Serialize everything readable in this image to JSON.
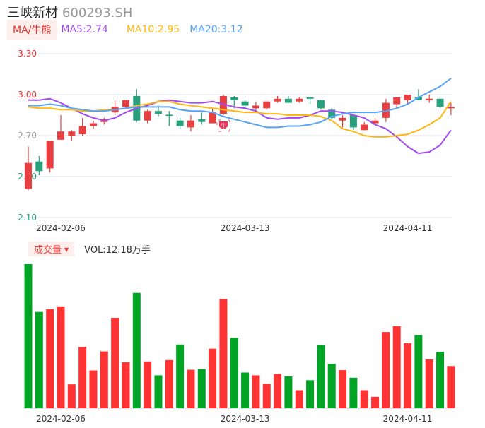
{
  "header": {
    "name": "三峡新材",
    "code": "600293.SH"
  },
  "ma_legend": {
    "tag": "MA/牛熊",
    "ma5": "MA5:2.74",
    "ma10": "MA10:2.95",
    "ma20": "MA20:3.12"
  },
  "volume_legend": {
    "tag": "成交量",
    "tag_icon": "triangle-down-icon",
    "value": "VOL:12.18万手"
  },
  "marker": {
    "label": "牛",
    "index": 18
  },
  "colors": {
    "up": "#e84040",
    "down": "#26a17c",
    "vol_up": "#ff3333",
    "vol_down": "#00a526",
    "ma5": "#a24bf0",
    "ma10": "#fdb714",
    "ma20": "#56a3f5",
    "grid": "#dde3f0"
  },
  "chart_data": [
    {
      "type": "candlestick",
      "title": "三峡新材 600293.SH",
      "ylim": [
        2.1,
        3.3
      ],
      "yticks": [
        "3.30",
        "3.00",
        "2.70",
        "2.40",
        "2.10"
      ],
      "ytick_values": [
        3.3,
        3.0,
        2.7,
        2.4,
        2.1
      ],
      "xtick_labels": [
        {
          "index": 3,
          "label": "2024-02-06"
        },
        {
          "index": 20,
          "label": "2024-03-13"
        },
        {
          "index": 35,
          "label": "2024-04-11"
        }
      ],
      "grid": true,
      "ohlc": [
        [
          2.31,
          2.62,
          2.3,
          2.5
        ],
        [
          2.51,
          2.55,
          2.41,
          2.44
        ],
        [
          2.46,
          2.66,
          2.43,
          2.66
        ],
        [
          2.67,
          2.85,
          2.67,
          2.73
        ],
        [
          2.7,
          2.74,
          2.66,
          2.73
        ],
        [
          2.71,
          2.83,
          2.7,
          2.77
        ],
        [
          2.77,
          2.81,
          2.75,
          2.79
        ],
        [
          2.8,
          2.83,
          2.78,
          2.82
        ],
        [
          2.87,
          2.96,
          2.85,
          2.91
        ],
        [
          2.91,
          2.96,
          2.9,
          2.96
        ],
        [
          2.99,
          3.04,
          2.8,
          2.81
        ],
        [
          2.81,
          2.89,
          2.79,
          2.88
        ],
        [
          2.88,
          2.92,
          2.84,
          2.86
        ],
        [
          2.853,
          2.88,
          2.77,
          2.848
        ],
        [
          2.81,
          2.83,
          2.75,
          2.77
        ],
        [
          2.76,
          2.85,
          2.73,
          2.81
        ],
        [
          2.82,
          2.87,
          2.78,
          2.8
        ],
        [
          2.79,
          2.9,
          2.79,
          2.87
        ],
        [
          2.86,
          3.0,
          2.85,
          2.99
        ],
        [
          2.98,
          2.99,
          2.9,
          2.96
        ],
        [
          2.95,
          2.96,
          2.9,
          2.92
        ],
        [
          2.9,
          2.95,
          2.88,
          2.92
        ],
        [
          2.9,
          2.95,
          2.89,
          2.95
        ],
        [
          2.95,
          2.99,
          2.94,
          2.97
        ],
        [
          2.97,
          2.99,
          2.94,
          2.94
        ],
        [
          2.95,
          2.98,
          2.94,
          2.97
        ],
        [
          2.98,
          2.99,
          2.93,
          2.97
        ],
        [
          2.96,
          2.96,
          2.89,
          2.9
        ],
        [
          2.89,
          2.9,
          2.82,
          2.83
        ],
        [
          2.81,
          2.85,
          2.76,
          2.83
        ],
        [
          2.85,
          2.85,
          2.74,
          2.76
        ],
        [
          2.74,
          2.8,
          2.74,
          2.78
        ],
        [
          2.79,
          2.83,
          2.78,
          2.81
        ],
        [
          2.83,
          2.97,
          2.8,
          2.94
        ],
        [
          2.93,
          2.98,
          2.9,
          2.98
        ],
        [
          2.96,
          3.0,
          2.93,
          3.0
        ],
        [
          2.98,
          3.04,
          2.96,
          2.96
        ],
        [
          2.96,
          3.0,
          2.94,
          2.97
        ],
        [
          2.97,
          2.97,
          2.9,
          2.91
        ],
        [
          2.9,
          2.94,
          2.85,
          2.91
        ]
      ],
      "series": [
        {
          "name": "MA5",
          "values": [
            2.96,
            2.96,
            2.97,
            2.94,
            2.9,
            2.86,
            2.83,
            2.81,
            2.83,
            2.87,
            2.9,
            2.92,
            2.95,
            2.96,
            2.95,
            2.94,
            2.94,
            2.95,
            2.93,
            2.91,
            2.9,
            2.88,
            2.83,
            2.82,
            2.83,
            2.83,
            2.85,
            2.88,
            2.88,
            2.87,
            2.85,
            2.83,
            2.78,
            2.75,
            2.69,
            2.62,
            2.57,
            2.58,
            2.63,
            2.74
          ]
        },
        {
          "name": "MA10",
          "values": [
            2.91,
            2.9,
            2.9,
            2.89,
            2.89,
            2.88,
            2.88,
            2.89,
            2.89,
            2.9,
            2.92,
            2.93,
            2.95,
            2.95,
            2.93,
            2.92,
            2.91,
            2.9,
            2.89,
            2.88,
            2.87,
            2.87,
            2.86,
            2.86,
            2.85,
            2.85,
            2.85,
            2.84,
            2.81,
            2.75,
            2.73,
            2.7,
            2.69,
            2.69,
            2.7,
            2.71,
            2.74,
            2.78,
            2.83,
            2.95
          ]
        },
        {
          "name": "MA20",
          "values": [
            2.92,
            2.92,
            2.93,
            2.92,
            2.9,
            2.89,
            2.88,
            2.88,
            2.89,
            2.9,
            2.91,
            2.91,
            2.91,
            2.91,
            2.89,
            2.88,
            2.88,
            2.87,
            2.84,
            2.82,
            2.8,
            2.78,
            2.76,
            2.76,
            2.77,
            2.77,
            2.78,
            2.8,
            2.84,
            2.86,
            2.87,
            2.87,
            2.87,
            2.88,
            2.9,
            2.93,
            2.98,
            3.02,
            3.06,
            3.12
          ]
        }
      ]
    },
    {
      "type": "bar",
      "title": "成交量",
      "unit": "万手",
      "values": [
        41.6,
        27.8,
        28.6,
        29.4,
        6.9,
        17.7,
        10.9,
        16.4,
        26.1,
        13.3,
        33.3,
        13.5,
        9.5,
        13.9,
        18.4,
        11.1,
        11.3,
        17.2,
        31.5,
        20.3,
        10.3,
        9.5,
        7.0,
        9.9,
        9.2,
        5.2,
        8.1,
        18.3,
        12.8,
        11.0,
        8.8,
        5.2,
        3.3,
        22.0,
        23.7,
        18.8,
        21.1,
        14.1,
        16.3,
        12.18
      ],
      "direction": [
        "d",
        "d",
        "u",
        "u",
        "u",
        "u",
        "u",
        "u",
        "u",
        "u",
        "d",
        "u",
        "d",
        "u",
        "d",
        "u",
        "d",
        "u",
        "u",
        "d",
        "d",
        "u",
        "u",
        "u",
        "d",
        "u",
        "d",
        "d",
        "d",
        "u",
        "d",
        "u",
        "u",
        "u",
        "u",
        "u",
        "d",
        "u",
        "d",
        "u"
      ],
      "ylim": [
        0,
        41.6
      ],
      "xtick_labels": [
        {
          "index": 3,
          "label": "2024-02-06"
        },
        {
          "index": 20,
          "label": "2024-03-13"
        },
        {
          "index": 35,
          "label": "2024-04-11"
        }
      ]
    }
  ]
}
